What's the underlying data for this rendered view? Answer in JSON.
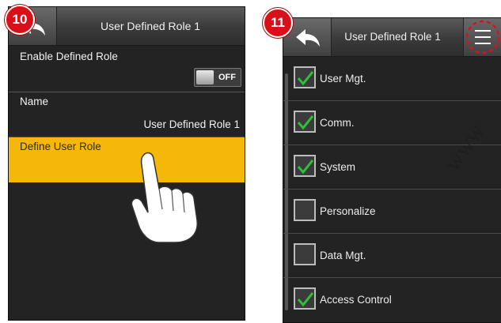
{
  "step_badges": [
    "10",
    "11"
  ],
  "screen1": {
    "title": "User Defined Role 1",
    "back_icon": "back-arrow-icon",
    "rows": {
      "enable_label": "Enable Defined Role",
      "toggle_state": "OFF",
      "name_label": "Name",
      "name_value": "User Defined Role 1",
      "define_label": "Define User Role"
    },
    "pointer_icon": "hand-pointer-icon",
    "highlight_color": "#f5b70a"
  },
  "screen2": {
    "title": "User Defined Role 1",
    "back_icon": "back-arrow-icon",
    "menu_icon": "hamburger-menu-icon",
    "items": [
      {
        "label": "User Mgt.",
        "checked": true
      },
      {
        "label": "Comm.",
        "checked": true
      },
      {
        "label": "System",
        "checked": true
      },
      {
        "label": "Personalize",
        "checked": false
      },
      {
        "label": "Data Mgt.",
        "checked": false
      },
      {
        "label": "Access Control",
        "checked": true
      }
    ],
    "check_color": "#2fbf3a"
  },
  "watermark": "www",
  "badge_color": "#d9101a"
}
